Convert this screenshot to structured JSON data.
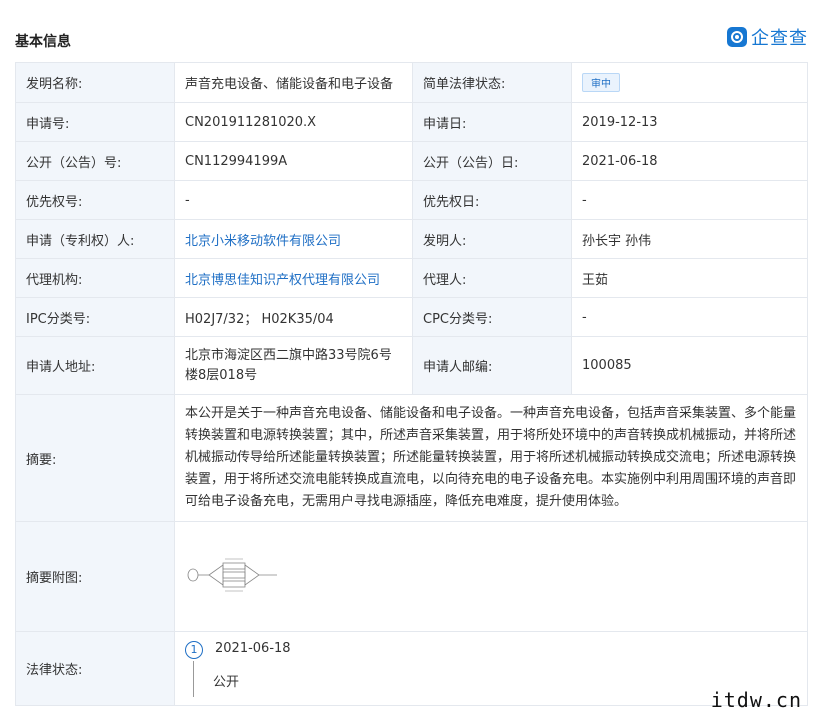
{
  "header": {
    "title": "基本信息",
    "brand": "企查查"
  },
  "rows": [
    {
      "l1": "发明名称:",
      "v1": "声音充电设备、储能设备和电子设备",
      "l2": "简单法律状态:",
      "v2": "审中"
    },
    {
      "l1": "申请号:",
      "v1": "CN201911281020.X",
      "l2": "申请日:",
      "v2": "2019-12-13"
    },
    {
      "l1": "公开（公告）号:",
      "v1": "CN112994199A",
      "l2": "公开（公告）日:",
      "v2": "2021-06-18"
    },
    {
      "l1": "优先权号:",
      "v1": "-",
      "l2": "优先权日:",
      "v2": "-"
    },
    {
      "l1": "申请（专利权）人:",
      "v1": "北京小米移动软件有限公司",
      "l2": "发明人:",
      "v2": "孙长宇 孙伟"
    },
    {
      "l1": "代理机构:",
      "v1": "北京博思佳知识产权代理有限公司",
      "l2": "代理人:",
      "v2": "王茹"
    },
    {
      "l1": "IPC分类号:",
      "v1": "H02J7/32；  H02K35/04",
      "l2": "CPC分类号:",
      "v2": "-"
    },
    {
      "l1": "申请人地址:",
      "v1": "北京市海淀区西二旗中路33号院6号楼8层018号",
      "l2": "申请人邮编:",
      "v2": "100085"
    }
  ],
  "abstract": {
    "label": "摘要:",
    "text": "本公开是关于一种声音充电设备、储能设备和电子设备。一种声音充电设备，包括声音采集装置、多个能量转换装置和电源转换装置；其中，所述声音采集装置，用于将所处环境中的声音转换成机械振动，并将所述机械振动传导给所述能量转换装置；所述能量转换装置，用于将所述机械振动转换成交流电；所述电源转换装置，用于将所述交流电能转换成直流电，以向待充电的电子设备充电。本实施例中利用周围环境的声音即可给电子设备充电，无需用户寻找电源插座，降低充电难度，提升使用体验。"
  },
  "figure": {
    "label": "摘要附图:"
  },
  "legal": {
    "label": "法律状态:",
    "step": "1",
    "date": "2021-06-18",
    "status": "公开"
  },
  "watermark": "itdw.cn"
}
